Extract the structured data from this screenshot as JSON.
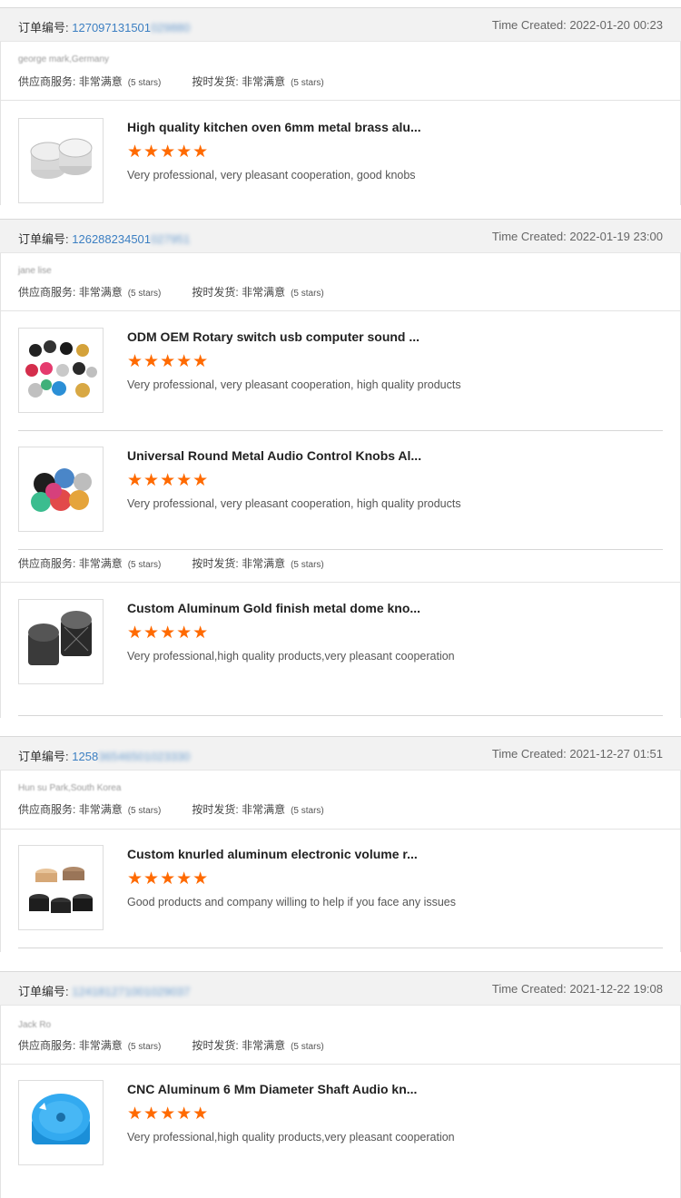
{
  "labels": {
    "order_no": "订单编号:",
    "supplier_service": "供应商服务:",
    "on_time_delivery": "按时发货:",
    "rating_value": "非常满意",
    "rating_stars": "(5 stars)",
    "star_glyphs": "★★★★★"
  },
  "orders": [
    {
      "order_no_visible": "127097131501",
      "order_no_blurred": "029880",
      "time": "Time Created: 2022-01-20 00:23",
      "buyer": "george mark,Germany",
      "items": [
        {
          "title": "High quality kitchen oven 6mm metal brass alu...",
          "comment": "Very professional, very pleasant cooperation, good knobs",
          "icon": "silver-knobs-icon"
        }
      ]
    },
    {
      "order_no_visible": "126288234501",
      "order_no_blurred": "027951",
      "time": "Time Created: 2022-01-19 23:00",
      "buyer": "jane lise",
      "items": [
        {
          "title": "ODM OEM Rotary switch usb computer sound ...",
          "comment": "Very professional, very pleasant cooperation, high quality products",
          "icon": "colorful-knobs-icon"
        },
        {
          "title": "Universal Round Metal Audio Control Knobs Al...",
          "comment": "Very professional, very pleasant cooperation, high quality products",
          "icon": "colored-audio-knobs-icon"
        },
        {
          "title": "Custom Aluminum Gold finish metal dome kno...",
          "comment": "Very professional,high quality products,very pleasant cooperation",
          "icon": "black-dome-knobs-icon"
        }
      ]
    },
    {
      "order_no_visible": "1258",
      "order_no_blurred": "36546501023330",
      "time": "Time Created: 2021-12-27 01:51",
      "buyer": "Hun su Park,South Korea",
      "items": [
        {
          "title": "Custom knurled aluminum electronic volume r...",
          "comment": "Good products and company willing to help if you face any issues",
          "icon": "knurled-knobs-icon"
        }
      ]
    },
    {
      "order_no_visible": "",
      "order_no_blurred": "124181271001029037",
      "time": "Time Created: 2021-12-22 19:08",
      "buyer": "Jack Ro",
      "items": [
        {
          "title": "CNC Aluminum 6 Mm Diameter Shaft Audio kn...",
          "comment": "Very professional,high quality products,very pleasant cooperation",
          "icon": "blue-knob-icon"
        }
      ]
    }
  ],
  "colors": {
    "star": "#ff6a00",
    "order_link": "#3c7fc2",
    "header_bg": "#f2f2f2"
  }
}
